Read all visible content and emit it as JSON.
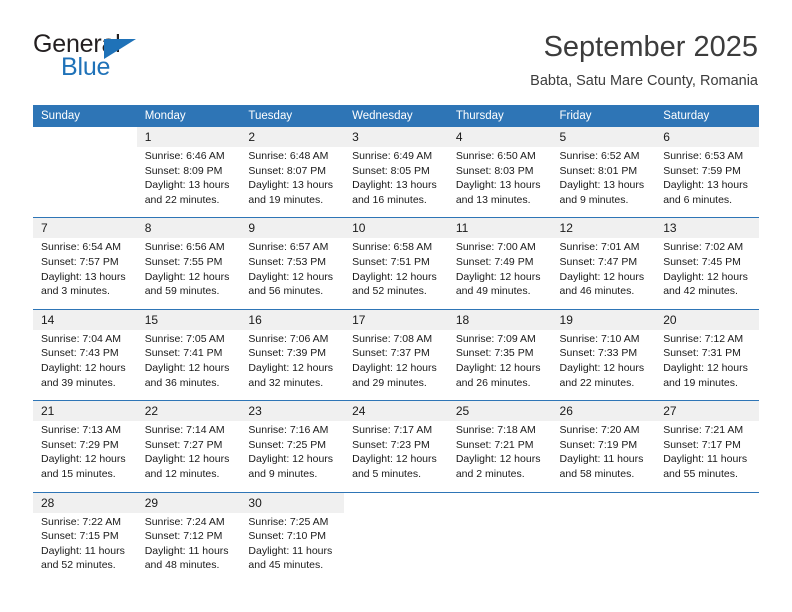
{
  "logo": {
    "general_text": "General",
    "blue_text": "Blue",
    "triangle_color": "#1f72b8"
  },
  "header": {
    "title": "September 2025",
    "subtitle": "Babta, Satu Mare County, Romania"
  },
  "theme": {
    "header_bg": "#2e75b6",
    "daynum_bg": "#f0f0f0",
    "rule_color": "#2e75b6",
    "text_color": "#1a1a1a"
  },
  "weekday_headers": [
    "Sunday",
    "Monday",
    "Tuesday",
    "Wednesday",
    "Thursday",
    "Friday",
    "Saturday"
  ],
  "weeks": [
    [
      {
        "day": "",
        "lines": []
      },
      {
        "day": "1",
        "lines": [
          "Sunrise: 6:46 AM",
          "Sunset: 8:09 PM",
          "Daylight: 13 hours",
          "and 22 minutes."
        ]
      },
      {
        "day": "2",
        "lines": [
          "Sunrise: 6:48 AM",
          "Sunset: 8:07 PM",
          "Daylight: 13 hours",
          "and 19 minutes."
        ]
      },
      {
        "day": "3",
        "lines": [
          "Sunrise: 6:49 AM",
          "Sunset: 8:05 PM",
          "Daylight: 13 hours",
          "and 16 minutes."
        ]
      },
      {
        "day": "4",
        "lines": [
          "Sunrise: 6:50 AM",
          "Sunset: 8:03 PM",
          "Daylight: 13 hours",
          "and 13 minutes."
        ]
      },
      {
        "day": "5",
        "lines": [
          "Sunrise: 6:52 AM",
          "Sunset: 8:01 PM",
          "Daylight: 13 hours",
          "and 9 minutes."
        ]
      },
      {
        "day": "6",
        "lines": [
          "Sunrise: 6:53 AM",
          "Sunset: 7:59 PM",
          "Daylight: 13 hours",
          "and 6 minutes."
        ]
      }
    ],
    [
      {
        "day": "7",
        "lines": [
          "Sunrise: 6:54 AM",
          "Sunset: 7:57 PM",
          "Daylight: 13 hours",
          "and 3 minutes."
        ]
      },
      {
        "day": "8",
        "lines": [
          "Sunrise: 6:56 AM",
          "Sunset: 7:55 PM",
          "Daylight: 12 hours",
          "and 59 minutes."
        ]
      },
      {
        "day": "9",
        "lines": [
          "Sunrise: 6:57 AM",
          "Sunset: 7:53 PM",
          "Daylight: 12 hours",
          "and 56 minutes."
        ]
      },
      {
        "day": "10",
        "lines": [
          "Sunrise: 6:58 AM",
          "Sunset: 7:51 PM",
          "Daylight: 12 hours",
          "and 52 minutes."
        ]
      },
      {
        "day": "11",
        "lines": [
          "Sunrise: 7:00 AM",
          "Sunset: 7:49 PM",
          "Daylight: 12 hours",
          "and 49 minutes."
        ]
      },
      {
        "day": "12",
        "lines": [
          "Sunrise: 7:01 AM",
          "Sunset: 7:47 PM",
          "Daylight: 12 hours",
          "and 46 minutes."
        ]
      },
      {
        "day": "13",
        "lines": [
          "Sunrise: 7:02 AM",
          "Sunset: 7:45 PM",
          "Daylight: 12 hours",
          "and 42 minutes."
        ]
      }
    ],
    [
      {
        "day": "14",
        "lines": [
          "Sunrise: 7:04 AM",
          "Sunset: 7:43 PM",
          "Daylight: 12 hours",
          "and 39 minutes."
        ]
      },
      {
        "day": "15",
        "lines": [
          "Sunrise: 7:05 AM",
          "Sunset: 7:41 PM",
          "Daylight: 12 hours",
          "and 36 minutes."
        ]
      },
      {
        "day": "16",
        "lines": [
          "Sunrise: 7:06 AM",
          "Sunset: 7:39 PM",
          "Daylight: 12 hours",
          "and 32 minutes."
        ]
      },
      {
        "day": "17",
        "lines": [
          "Sunrise: 7:08 AM",
          "Sunset: 7:37 PM",
          "Daylight: 12 hours",
          "and 29 minutes."
        ]
      },
      {
        "day": "18",
        "lines": [
          "Sunrise: 7:09 AM",
          "Sunset: 7:35 PM",
          "Daylight: 12 hours",
          "and 26 minutes."
        ]
      },
      {
        "day": "19",
        "lines": [
          "Sunrise: 7:10 AM",
          "Sunset: 7:33 PM",
          "Daylight: 12 hours",
          "and 22 minutes."
        ]
      },
      {
        "day": "20",
        "lines": [
          "Sunrise: 7:12 AM",
          "Sunset: 7:31 PM",
          "Daylight: 12 hours",
          "and 19 minutes."
        ]
      }
    ],
    [
      {
        "day": "21",
        "lines": [
          "Sunrise: 7:13 AM",
          "Sunset: 7:29 PM",
          "Daylight: 12 hours",
          "and 15 minutes."
        ]
      },
      {
        "day": "22",
        "lines": [
          "Sunrise: 7:14 AM",
          "Sunset: 7:27 PM",
          "Daylight: 12 hours",
          "and 12 minutes."
        ]
      },
      {
        "day": "23",
        "lines": [
          "Sunrise: 7:16 AM",
          "Sunset: 7:25 PM",
          "Daylight: 12 hours",
          "and 9 minutes."
        ]
      },
      {
        "day": "24",
        "lines": [
          "Sunrise: 7:17 AM",
          "Sunset: 7:23 PM",
          "Daylight: 12 hours",
          "and 5 minutes."
        ]
      },
      {
        "day": "25",
        "lines": [
          "Sunrise: 7:18 AM",
          "Sunset: 7:21 PM",
          "Daylight: 12 hours",
          "and 2 minutes."
        ]
      },
      {
        "day": "26",
        "lines": [
          "Sunrise: 7:20 AM",
          "Sunset: 7:19 PM",
          "Daylight: 11 hours",
          "and 58 minutes."
        ]
      },
      {
        "day": "27",
        "lines": [
          "Sunrise: 7:21 AM",
          "Sunset: 7:17 PM",
          "Daylight: 11 hours",
          "and 55 minutes."
        ]
      }
    ],
    [
      {
        "day": "28",
        "lines": [
          "Sunrise: 7:22 AM",
          "Sunset: 7:15 PM",
          "Daylight: 11 hours",
          "and 52 minutes."
        ]
      },
      {
        "day": "29",
        "lines": [
          "Sunrise: 7:24 AM",
          "Sunset: 7:12 PM",
          "Daylight: 11 hours",
          "and 48 minutes."
        ]
      },
      {
        "day": "30",
        "lines": [
          "Sunrise: 7:25 AM",
          "Sunset: 7:10 PM",
          "Daylight: 11 hours",
          "and 45 minutes."
        ]
      },
      {
        "day": "",
        "lines": []
      },
      {
        "day": "",
        "lines": []
      },
      {
        "day": "",
        "lines": []
      },
      {
        "day": "",
        "lines": []
      }
    ]
  ]
}
